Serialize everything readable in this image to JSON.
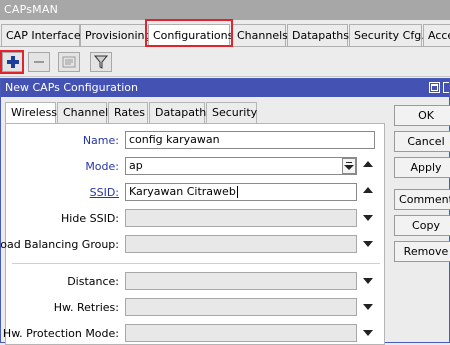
{
  "app": {
    "title": "CAPsMAN"
  },
  "tabs": [
    {
      "label": "CAP Interface"
    },
    {
      "label": "Provisioning"
    },
    {
      "label": "Configurations"
    },
    {
      "label": "Channels"
    },
    {
      "label": "Datapaths"
    },
    {
      "label": "Security Cfg."
    },
    {
      "label": "Acce"
    }
  ],
  "toolbar": {
    "add_icon": "plus-icon",
    "remove_icon": "minus-icon",
    "comment_icon": "comment-icon",
    "filter_icon": "filter-icon"
  },
  "dialog": {
    "title": "New CAPs Configuration",
    "tabs": [
      {
        "label": "Wireless"
      },
      {
        "label": "Channel"
      },
      {
        "label": "Rates"
      },
      {
        "label": "Datapath"
      },
      {
        "label": "Security"
      }
    ],
    "fields": {
      "name": {
        "label": "Name:",
        "value": "config karyawan"
      },
      "mode": {
        "label": "Mode:",
        "value": "ap"
      },
      "ssid": {
        "label": "SSID:",
        "value": "Karyawan Citraweb"
      },
      "hide_ssid": {
        "label": "Hide SSID:",
        "value": ""
      },
      "load_balancing": {
        "label": "Load Balancing Group:",
        "value": ""
      },
      "distance": {
        "label": "Distance:",
        "value": ""
      },
      "hw_retries": {
        "label": "Hw. Retries:",
        "value": ""
      },
      "hw_protection": {
        "label": "Hw. Protection Mode:",
        "value": ""
      }
    },
    "buttons": {
      "ok": "OK",
      "cancel": "Cancel",
      "apply": "Apply",
      "comment": "Comment",
      "copy": "Copy",
      "remove": "Remove"
    }
  },
  "colors": {
    "highlight": "#e0232c",
    "dialog_title_bg": "#4352b3",
    "label_blue": "#2734a8",
    "add_icon": "#1c3e9c"
  }
}
